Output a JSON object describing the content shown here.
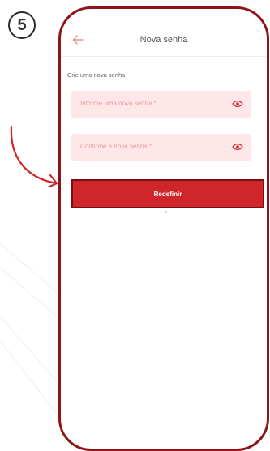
{
  "step": {
    "number": "5"
  },
  "screen": {
    "title": "Nova senha",
    "subtitle": "Crie uma nova senha",
    "fields": [
      {
        "placeholder": "Informe uma nova senha *",
        "icon": "eye-icon"
      },
      {
        "placeholder": "Confirme a nova senha *",
        "icon": "eye-icon"
      }
    ],
    "submit_label": "Redefinir"
  },
  "colors": {
    "accent": "#d1252c",
    "frame": "#8e1418",
    "field_bg": "#fde7e8",
    "placeholder": "#ee9a9f"
  }
}
